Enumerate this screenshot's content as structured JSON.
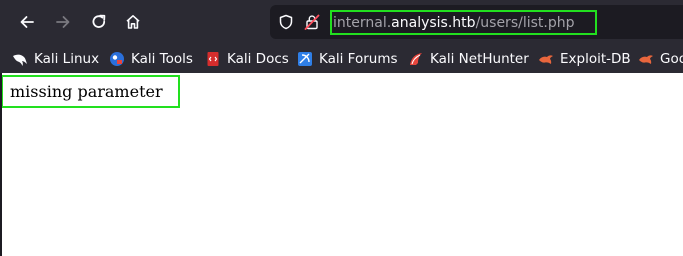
{
  "browser": {
    "nav": {
      "back": "back-arrow-icon",
      "forward": "forward-arrow-icon",
      "reload": "reload-icon",
      "home": "home-icon"
    },
    "url": {
      "subdomain": "internal.",
      "host": "analysis.htb",
      "path": "/users/list.php",
      "highlight_color": "#22e01f"
    },
    "bookmarks": [
      {
        "label": "Kali Linux",
        "icon": "kali-dragon-icon"
      },
      {
        "label": "Kali Tools",
        "icon": "kali-tools-icon"
      },
      {
        "label": "Kali Docs",
        "icon": "kali-docs-icon"
      },
      {
        "label": "Kali Forums",
        "icon": "kali-forums-icon"
      },
      {
        "label": "Kali NetHunter",
        "icon": "kali-nethunter-icon"
      },
      {
        "label": "Exploit-DB",
        "icon": "exploit-db-icon"
      },
      {
        "label": "Goo",
        "icon": "google-hacking-db-icon"
      }
    ]
  },
  "page": {
    "message": "missing parameter"
  },
  "colors": {
    "chrome_bg": "#2b2a33",
    "urlbar_bg": "#1c1b22",
    "highlight": "#22e01f"
  }
}
